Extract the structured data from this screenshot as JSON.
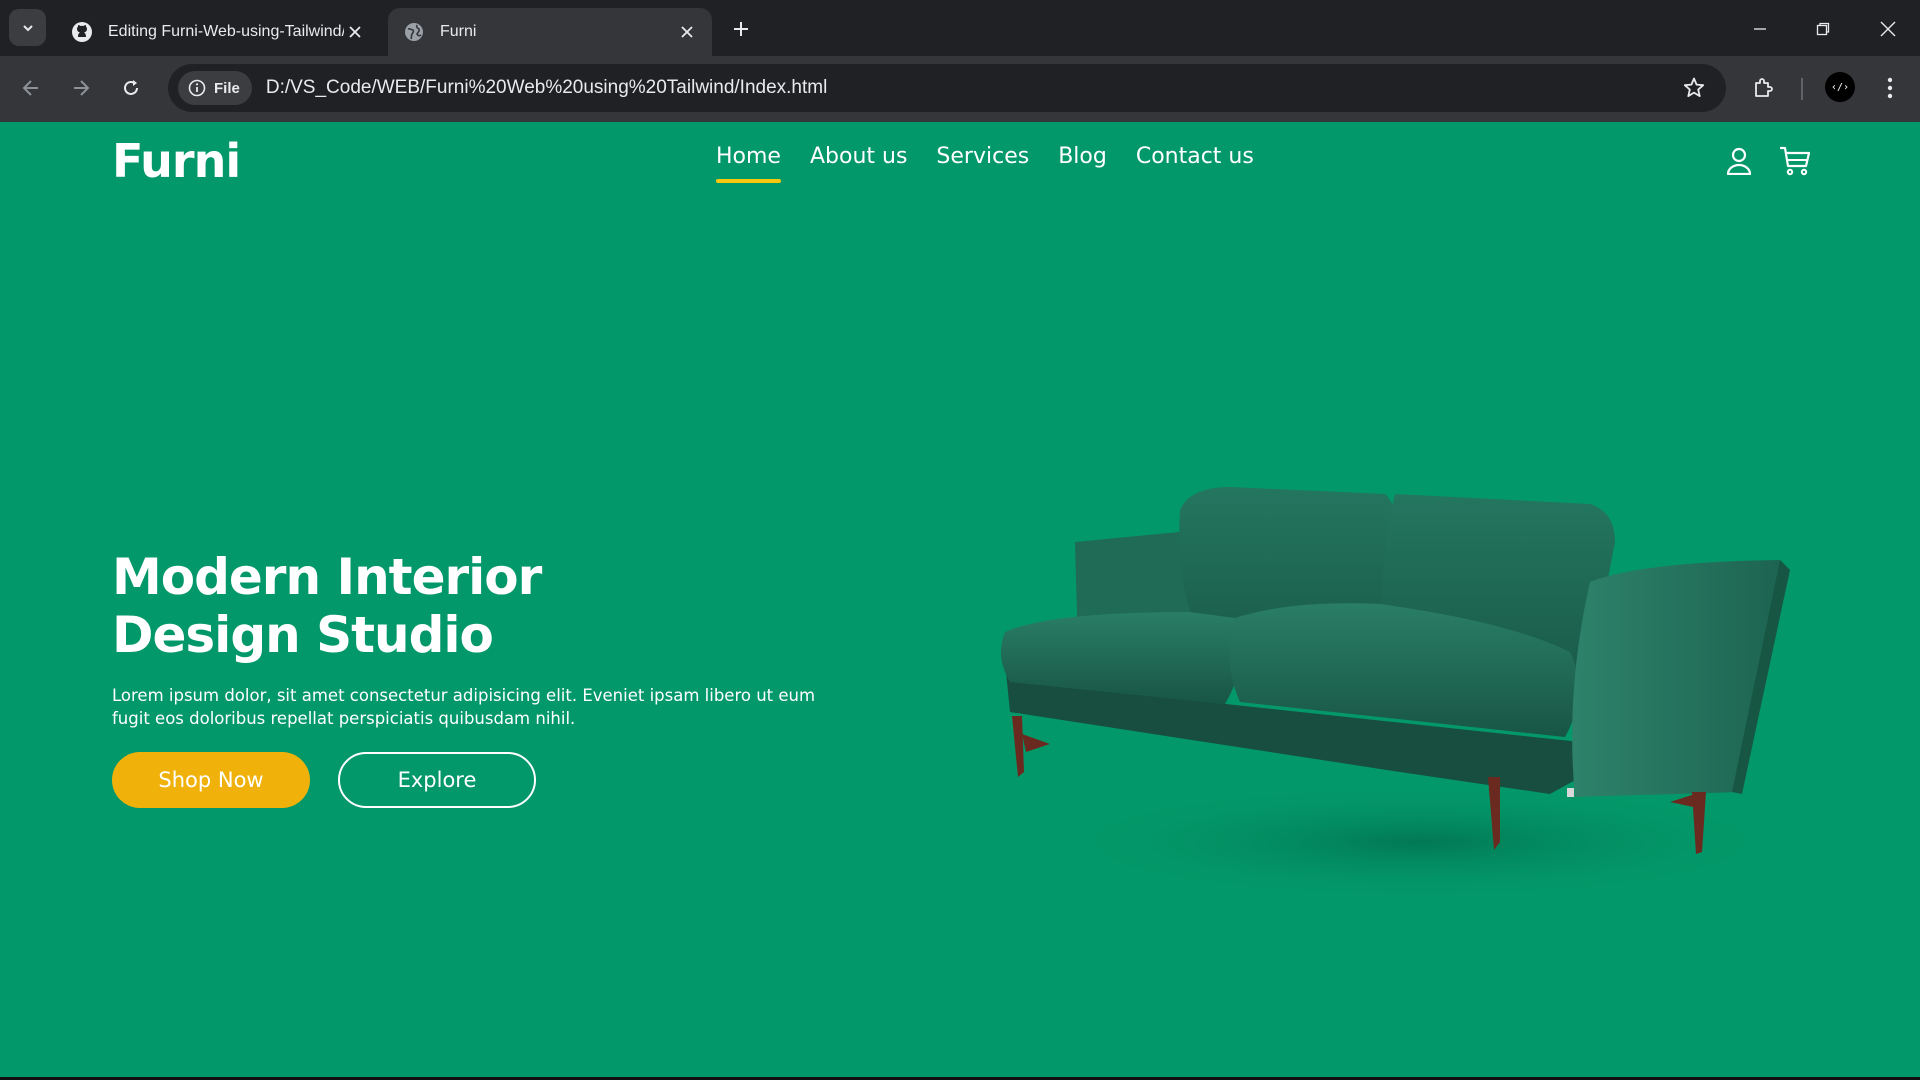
{
  "browser": {
    "tabs": [
      {
        "title": "Editing Furni-Web-using-Tailwind/",
        "icon": "github-icon"
      },
      {
        "title": "Furni",
        "icon": "globe-icon"
      }
    ],
    "address": {
      "chip_label": "File",
      "url": "D:/VS_Code/WEB/Furni%20Web%20using%20Tailwind/Index.html"
    },
    "profile_label": "‹/›"
  },
  "page": {
    "logo": "Furni",
    "nav": [
      "Home",
      "About us",
      "Services",
      "Blog",
      "Contact us"
    ],
    "active_nav": "Home",
    "hero": {
      "title_line1": "Modern Interior",
      "title_line2": "Design Studio",
      "description": "Lorem ipsum dolor, sit amet consectetur adipisicing elit. Eveniet ipsam libero ut eum fugit eos doloribus repellat perspiciatis quibusdam nihil.",
      "primary_button": "Shop Now",
      "secondary_button": "Explore"
    }
  },
  "colors": {
    "background": "#039869",
    "accent": "#f0b20a",
    "nav_underline": "#f9c80e",
    "text": "#ffffff",
    "sofa": "#1f6b55"
  }
}
